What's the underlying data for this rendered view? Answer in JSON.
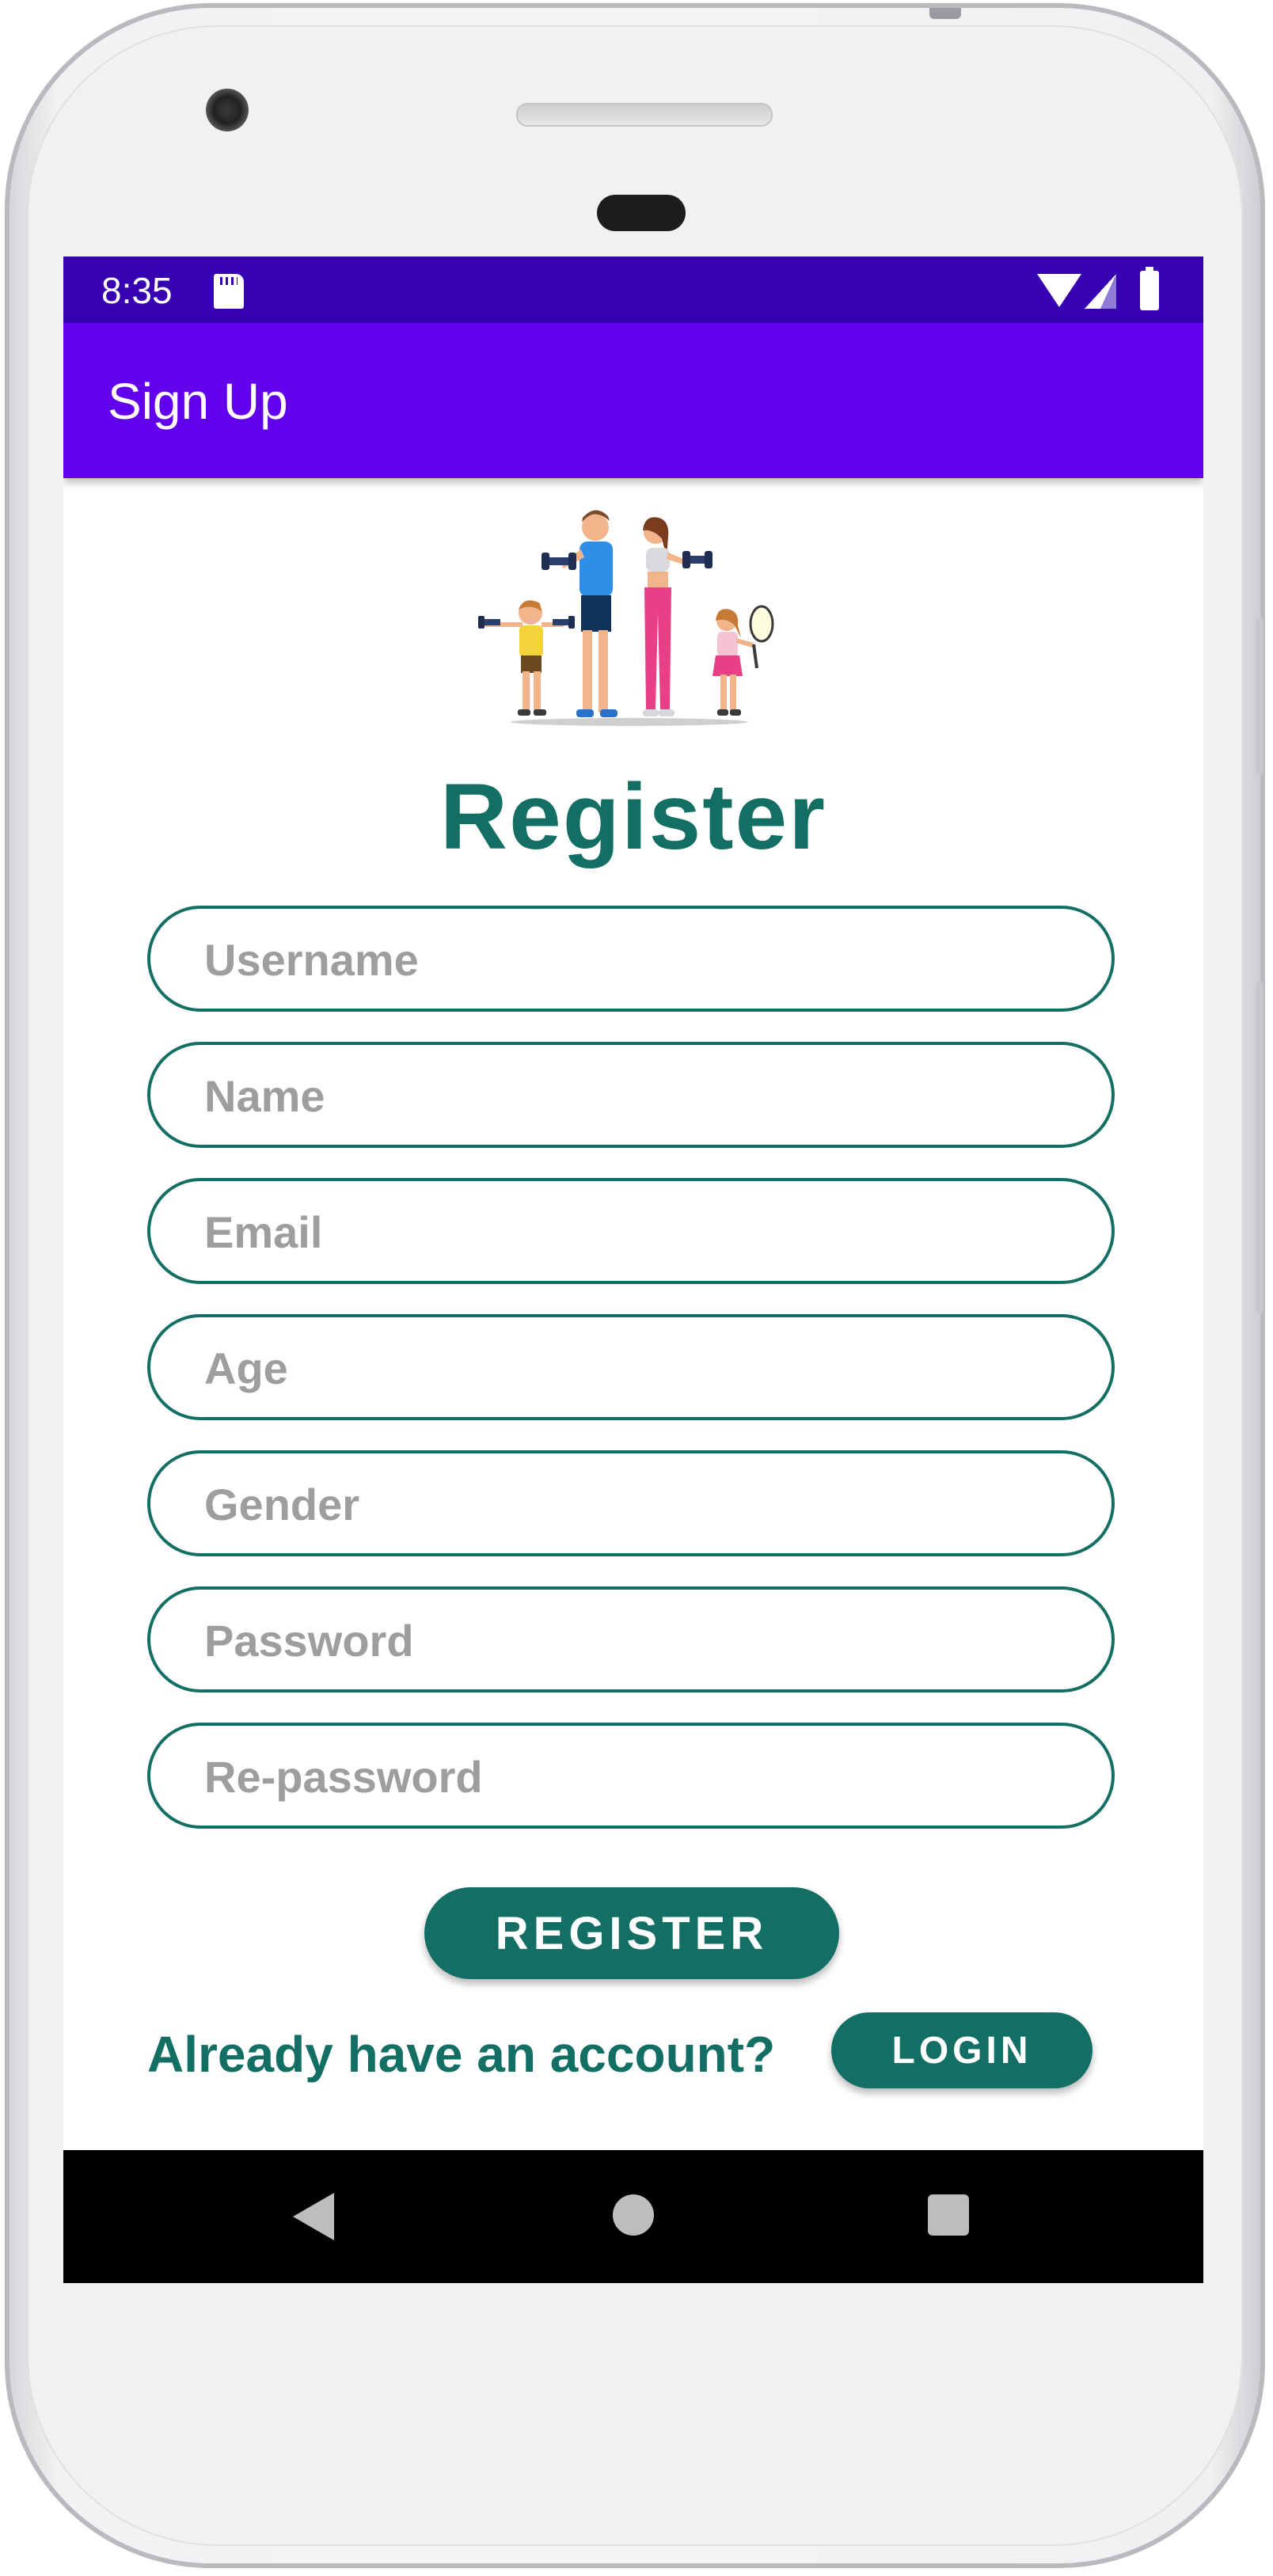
{
  "status_bar": {
    "time": "8:35"
  },
  "app_bar": {
    "title": "Sign Up"
  },
  "form": {
    "heading": "Register",
    "fields": [
      {
        "placeholder": "Username"
      },
      {
        "placeholder": "Name"
      },
      {
        "placeholder": "Email"
      },
      {
        "placeholder": "Age"
      },
      {
        "placeholder": "Gender"
      },
      {
        "placeholder": "Password"
      },
      {
        "placeholder": "Re-password"
      }
    ],
    "register_label": "REGISTER",
    "login_prompt": "Already have an account?",
    "login_label": "LOGIN"
  },
  "colors": {
    "status_bar": "#3700b3",
    "app_bar": "#6200ee",
    "accent": "#136f63"
  },
  "icons": {
    "status": [
      "sd-card-icon",
      "wifi-icon",
      "signal-icon",
      "battery-icon"
    ],
    "nav": [
      "back-icon",
      "home-icon",
      "recents-icon"
    ]
  }
}
